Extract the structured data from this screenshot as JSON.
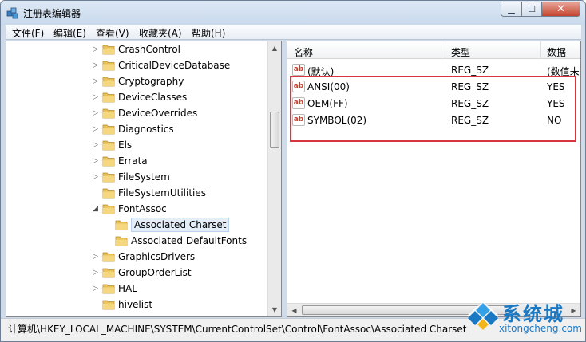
{
  "window": {
    "title": "注册表编辑器"
  },
  "menu": [
    "文件(F)",
    "编辑(E)",
    "查看(V)",
    "收藏夹(A)",
    "帮助(H)"
  ],
  "tree": {
    "items": [
      {
        "label": "CrashControl",
        "level": 0,
        "expander": "collapsed"
      },
      {
        "label": "CriticalDeviceDatabase",
        "level": 0,
        "expander": "collapsed"
      },
      {
        "label": "Cryptography",
        "level": 0,
        "expander": "collapsed"
      },
      {
        "label": "DeviceClasses",
        "level": 0,
        "expander": "collapsed"
      },
      {
        "label": "DeviceOverrides",
        "level": 0,
        "expander": "collapsed"
      },
      {
        "label": "Diagnostics",
        "level": 0,
        "expander": "collapsed"
      },
      {
        "label": "Els",
        "level": 0,
        "expander": "collapsed"
      },
      {
        "label": "Errata",
        "level": 0,
        "expander": "collapsed"
      },
      {
        "label": "FileSystem",
        "level": 0,
        "expander": "collapsed"
      },
      {
        "label": "FileSystemUtilities",
        "level": 0,
        "expander": "none"
      },
      {
        "label": "FontAssoc",
        "level": 0,
        "expander": "expanded"
      },
      {
        "label": "Associated Charset",
        "level": 1,
        "expander": "none",
        "selected": true
      },
      {
        "label": "Associated DefaultFonts",
        "level": 1,
        "expander": "none"
      },
      {
        "label": "GraphicsDrivers",
        "level": 0,
        "expander": "collapsed"
      },
      {
        "label": "GroupOrderList",
        "level": 0,
        "expander": "collapsed"
      },
      {
        "label": "HAL",
        "level": 0,
        "expander": "collapsed"
      },
      {
        "label": "hivelist",
        "level": 0,
        "expander": "none"
      }
    ]
  },
  "values_list": {
    "columns": [
      "名称",
      "类型",
      "数据"
    ],
    "rows": [
      {
        "name": "(默认)",
        "type": "REG_SZ",
        "data": "(数值未"
      },
      {
        "name": "ANSI(00)",
        "type": "REG_SZ",
        "data": "YES"
      },
      {
        "name": "OEM(FF)",
        "type": "REG_SZ",
        "data": "YES"
      },
      {
        "name": "SYMBOL(02)",
        "type": "REG_SZ",
        "data": "NO"
      }
    ]
  },
  "status": {
    "path": "计算机\\HKEY_LOCAL_MACHINE\\SYSTEM\\CurrentControlSet\\Control\\FontAssoc\\Associated Charset"
  },
  "watermark": {
    "title": "系统城",
    "url": "xitongcheng.com"
  },
  "icons": {
    "app": "registry-editor-icon",
    "folder": "folder-icon",
    "value": "string-value-icon"
  },
  "colors": {
    "highlight_border": "#d7363e",
    "folder": "#e8c15a",
    "brand_blue": "#1b79c4"
  }
}
